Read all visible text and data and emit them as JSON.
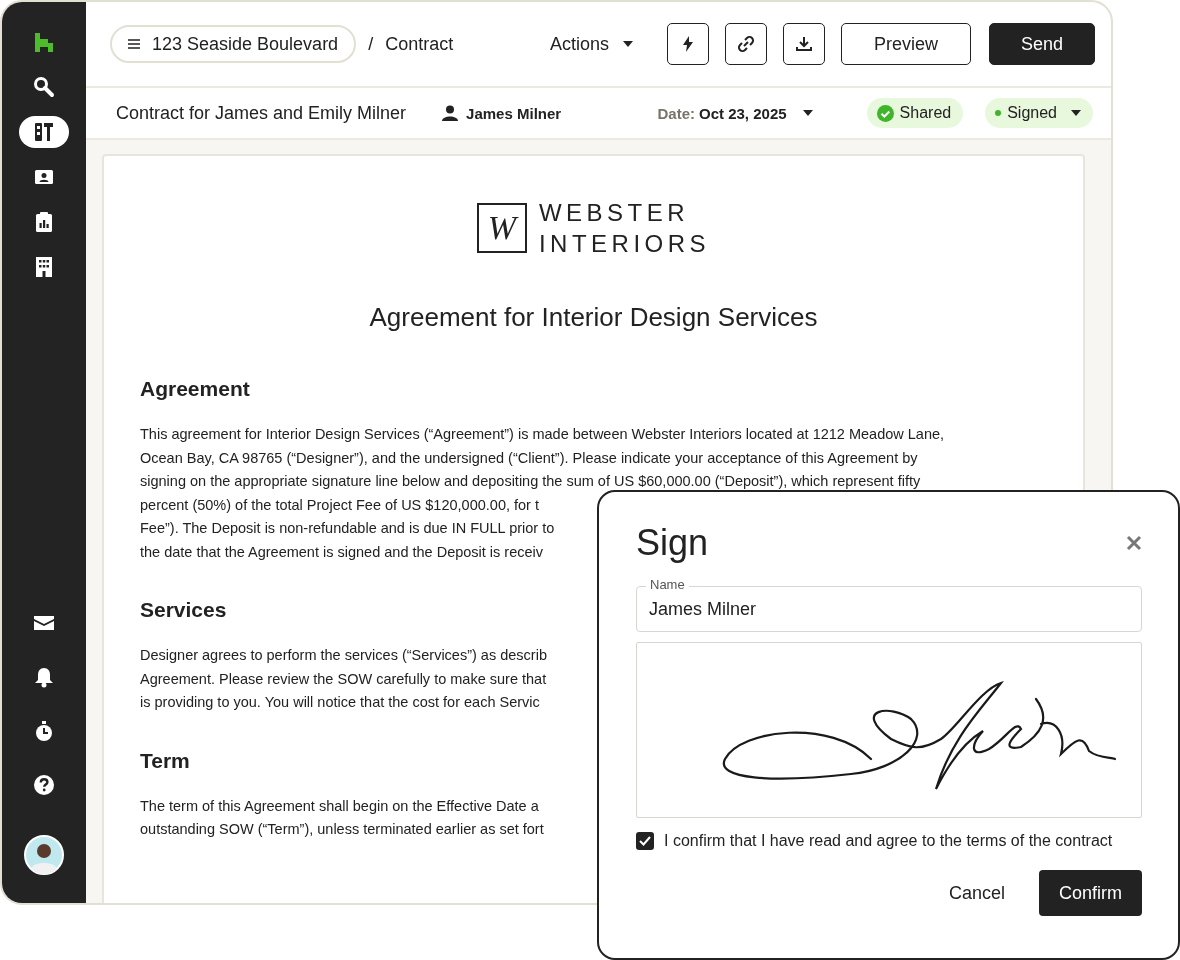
{
  "sidebar": {
    "top_items": [
      {
        "selected": false
      },
      {
        "selected": false
      },
      {
        "selected": true
      },
      {
        "selected": false
      },
      {
        "selected": false
      },
      {
        "selected": false
      }
    ],
    "bottom_items": [
      {
        "selected": false
      },
      {
        "selected": false
      },
      {
        "selected": false
      },
      {
        "selected": false
      }
    ]
  },
  "header": {
    "project": "123 Seaside Boulevard",
    "separator": "/",
    "page": "Contract",
    "actions": "Actions",
    "buttons": [
      {
        "label": "Preview",
        "primary": false
      },
      {
        "label": "Send",
        "primary": true
      }
    ]
  },
  "subheader": {
    "title": "Contract for James and Emily Milner",
    "user": "James Milner",
    "date_label": "Date:",
    "date": "Oct 23, 2025",
    "statuses": [
      {
        "kind": "check",
        "label": "Shared"
      },
      {
        "kind": "dropdown",
        "label": "Signed"
      }
    ]
  },
  "document": {
    "logo_mark": "W",
    "logo_lines": [
      "WEBSTER",
      "INTERIORS"
    ],
    "title": "Agreement for Interior Design Services",
    "sections": [
      {
        "heading": "Agreement",
        "lines": [
          "This agreement for Interior Design Services (“Agreement”) is made between Webster Interiors located at 1212 Meadow Lane,",
          "Ocean Bay, CA 98765 (“Designer”), and the undersigned (“Client”). Please indicate your acceptance of this Agreement by",
          "signing on the appropriate signature line below and depositing the sum of US $60,000.00 (“Deposit”), which represent fifty",
          "percent (50%) of the total Project Fee of US $120,000.00, for t",
          "Fee”). The Deposit is non-refundable and is due IN FULL prior to",
          "the date that the Agreement is signed and the Deposit is receiv"
        ]
      },
      {
        "heading": "Services",
        "lines": [
          "Designer agrees to perform the services (“Services”) as describ",
          "Agreement. Please review the SOW carefully to make sure that",
          "is providing to you. You will notice that the cost for each Servic"
        ]
      },
      {
        "heading": "Term",
        "lines": [
          "The term of this Agreement shall begin on the Effective Date a",
          "outstanding SOW (“Term”), unless terminated earlier as set fort"
        ]
      }
    ]
  },
  "dialog": {
    "title": "Sign",
    "name_label": "Name",
    "name_value": "James Milner",
    "confirm_checked": true,
    "confirm_text": "I confirm that I have read and agree to the terms of the contract",
    "buttons": [
      {
        "label": "Cancel",
        "primary": false
      },
      {
        "label": "Confirm",
        "primary": true
      }
    ]
  }
}
